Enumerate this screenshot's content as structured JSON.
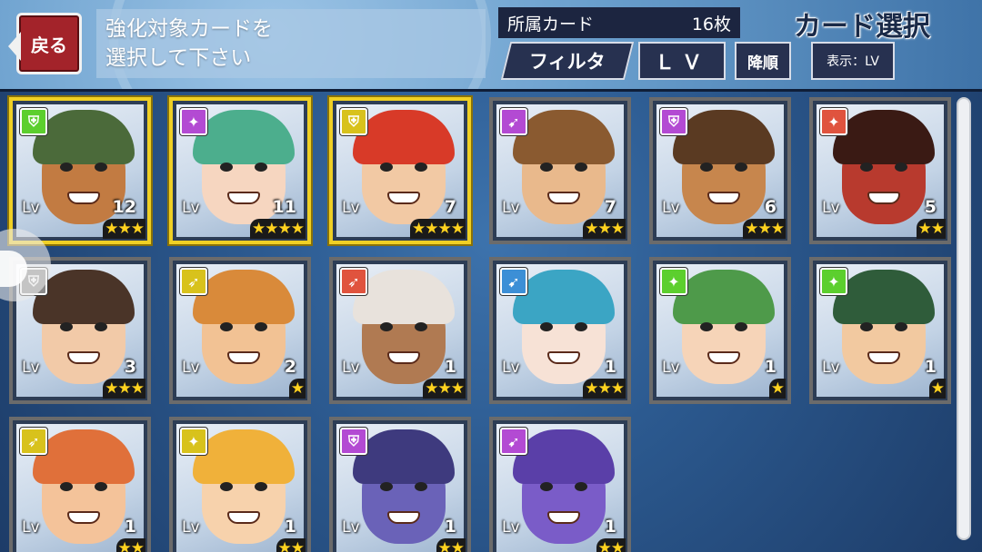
{
  "header": {
    "back_label": "戻る",
    "instruction_line1": "強化対象カードを",
    "instruction_line2": "選択して下さい",
    "owned_label": "所属カード",
    "owned_count": "16枚",
    "title": "カード選択",
    "filter_label": "フィルタ",
    "sort_key_label": "ＬＶ",
    "order_label": "降順",
    "display_label": "表示：LV"
  },
  "colors": {
    "weapon_green": "#5ccf2e",
    "weapon_purple": "#b34ad3",
    "weapon_yellow": "#d8c21c",
    "weapon_red": "#e0533e",
    "weapon_blue": "#3c8fd6",
    "frame_gold": "#f0d024",
    "frame_gray": "#6b6b6b",
    "star": "#ffd21f"
  },
  "cards": [
    {
      "lv_label": "Lv",
      "level": "12",
      "stars": "★★★",
      "weapon_icon": "shield-icon",
      "weapon_color": "#5ccf2e",
      "frame": "gold",
      "hair": "#4b6a3a",
      "skin": "#c27b42"
    },
    {
      "lv_label": "Lv",
      "level": "11",
      "stars": "★★★★",
      "weapon_icon": "mace-icon",
      "weapon_color": "#b34ad3",
      "frame": "gold",
      "hair": "#4cae8d",
      "skin": "#f6d6c0"
    },
    {
      "lv_label": "Lv",
      "level": "7",
      "stars": "★★★★",
      "weapon_icon": "shield-icon",
      "weapon_color": "#d8c21c",
      "frame": "gold",
      "hair": "#d83a28",
      "skin": "#f2c9a4"
    },
    {
      "lv_label": "Lv",
      "level": "7",
      "stars": "★★★",
      "weapon_icon": "bow-icon",
      "weapon_color": "#b34ad3",
      "frame": "gray",
      "hair": "#8a5a30",
      "skin": "#e9b98c"
    },
    {
      "lv_label": "Lv",
      "level": "6",
      "stars": "★★★",
      "weapon_icon": "shield-icon",
      "weapon_color": "#b34ad3",
      "frame": "gray",
      "hair": "#5a3a22",
      "skin": "#c7864d"
    },
    {
      "lv_label": "Lv",
      "level": "5",
      "stars": "★★",
      "weapon_icon": "mace-icon",
      "weapon_color": "#e0533e",
      "frame": "gray",
      "hair": "#3a1a14",
      "skin": "#b83a2e"
    },
    {
      "lv_label": "Lv",
      "level": "3",
      "stars": "★★★",
      "weapon_icon": "shield-icon",
      "weapon_color": "#8a8a8a",
      "frame": "gray",
      "hair": "#4a3428",
      "skin": "#f2caa8"
    },
    {
      "lv_label": "Lv",
      "level": "2",
      "stars": "★",
      "weapon_icon": "spear-icon",
      "weapon_color": "#d8c21c",
      "frame": "gray",
      "hair": "#d98a3a",
      "skin": "#f2c294"
    },
    {
      "lv_label": "Lv",
      "level": "1",
      "stars": "★★★",
      "weapon_icon": "spear-icon",
      "weapon_color": "#e0533e",
      "frame": "gray",
      "hair": "#e8e2dc",
      "skin": "#b07a52"
    },
    {
      "lv_label": "Lv",
      "level": "1",
      "stars": "★★★",
      "weapon_icon": "bow-icon",
      "weapon_color": "#3c8fd6",
      "frame": "gray",
      "hair": "#3ba5c4",
      "skin": "#f7e2d6"
    },
    {
      "lv_label": "Lv",
      "level": "1",
      "stars": "★",
      "weapon_icon": "mace-icon",
      "weapon_color": "#5ccf2e",
      "frame": "gray",
      "hair": "#4e9a4a",
      "skin": "#f6d4b8"
    },
    {
      "lv_label": "Lv",
      "level": "1",
      "stars": "★",
      "weapon_icon": "mace-icon",
      "weapon_color": "#5ccf2e",
      "frame": "gray",
      "hair": "#2f5c3a",
      "skin": "#f2c9a0"
    },
    {
      "lv_label": "Lv",
      "level": "1",
      "stars": "★★",
      "weapon_icon": "spear-icon",
      "weapon_color": "#d8c21c",
      "frame": "gray",
      "hair": "#e0703a",
      "skin": "#f4c39a"
    },
    {
      "lv_label": "Lv",
      "level": "1",
      "stars": "★★",
      "weapon_icon": "mace-icon",
      "weapon_color": "#d8c21c",
      "frame": "gray",
      "hair": "#f0b13a",
      "skin": "#f7d2ac"
    },
    {
      "lv_label": "Lv",
      "level": "1",
      "stars": "★★",
      "weapon_icon": "shield-icon",
      "weapon_color": "#b34ad3",
      "frame": "gray",
      "hair": "#3e3a7e",
      "skin": "#6a62b8"
    },
    {
      "lv_label": "Lv",
      "level": "1",
      "stars": "★★",
      "weapon_icon": "bow-icon",
      "weapon_color": "#b34ad3",
      "frame": "gray",
      "hair": "#5a3fa8",
      "skin": "#7a5cc8"
    }
  ]
}
